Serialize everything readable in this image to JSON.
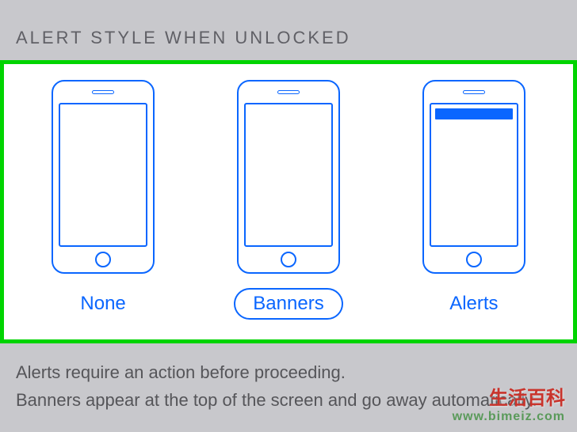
{
  "section_header": "ALERT STYLE WHEN UNLOCKED",
  "options": {
    "none": {
      "label": "None",
      "selected": false,
      "has_banner": false
    },
    "banners": {
      "label": "Banners",
      "selected": true,
      "has_banner": false
    },
    "alerts": {
      "label": "Alerts",
      "selected": false,
      "has_banner": true
    }
  },
  "description": {
    "line1": "Alerts require an action before proceeding.",
    "line2": "Banners appear at the top of the screen and go away automatically."
  },
  "watermark": {
    "title": "生活百科",
    "url": "www.bimeiz.com"
  }
}
